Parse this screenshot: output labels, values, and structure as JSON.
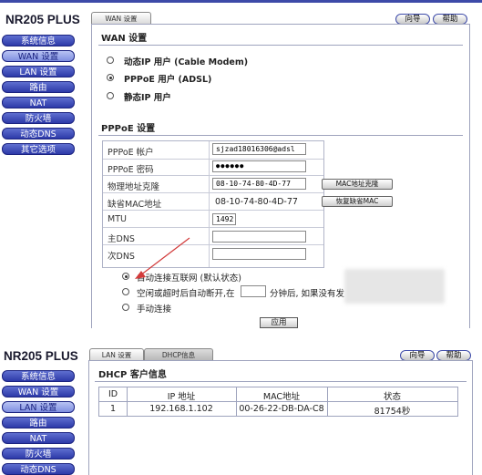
{
  "top": {
    "brand": "NR205 PLUS",
    "tab_wan": "WAN 设置",
    "wizard_button": "向导",
    "help_button": "帮助",
    "nav": [
      "系统信息",
      "WAN 设置",
      "LAN 设置",
      "路由",
      "NAT",
      "防火墙",
      "动态DNS",
      "其它选项"
    ],
    "nav_active_index": 1,
    "wan_section_title": "WAN 设置",
    "wan_modes": [
      {
        "label": "动态IP 用户 (Cable Modem)",
        "selected": false
      },
      {
        "label": "PPPoE 用户 (ADSL)",
        "selected": true
      },
      {
        "label": "静态IP 用户",
        "selected": false
      }
    ],
    "pppoe_section_title": "PPPoE 设置",
    "fields": {
      "account_label": "PPPoE 帐户",
      "account_value": "sjzad18016306@adsl",
      "password_label": "PPPoE 密码",
      "password_value": "●●●●●●",
      "clone_mac_label": "物理地址克隆",
      "clone_mac_value": "08-10-74-80-4D-77",
      "clone_mac_button": "MAC地址克隆",
      "default_mac_label": "缺省MAC地址",
      "default_mac_value": "08-10-74-80-4D-77",
      "restore_mac_button": "恢复缺省MAC",
      "mtu_label": "MTU",
      "mtu_value": "1492",
      "dns1_label": "主DNS",
      "dns1_value": "",
      "dns2_label": "次DNS",
      "dns2_value": ""
    },
    "connect_modes": [
      {
        "label": "自动连接互联网 (默认状态)",
        "selected": true
      },
      {
        "label": "空闲或超时后自动断开,在",
        "selected": false
      },
      {
        "label": "手动连接",
        "selected": false
      }
    ],
    "idle_suffix": "分钟后, 如果没有发",
    "apply_button": "应用"
  },
  "bottom": {
    "brand": "NR205 PLUS",
    "tab_lan": "LAN 设置",
    "tab_dhcp": "DHCP信息",
    "wizard_button": "向导",
    "help_button": "帮助",
    "nav": [
      "系统信息",
      "WAN 设置",
      "LAN 设置",
      "路由",
      "NAT",
      "防火墙",
      "动态DNS"
    ],
    "nav_active_index": 2,
    "dhcp_title": "DHCP 客户信息",
    "columns": [
      "ID",
      "IP 地址",
      "MAC地址",
      "状态"
    ],
    "rows": [
      {
        "id": "1",
        "ip": "192.168.1.102",
        "mac": "00-26-22-DB-DA-C8",
        "status": "81754秒"
      }
    ]
  },
  "colors": {
    "nav_blue": "#2d3aa8",
    "nav_active": "#b8c3f3",
    "border": "#9ea3bd",
    "arrow_red": "#d23a3a"
  }
}
